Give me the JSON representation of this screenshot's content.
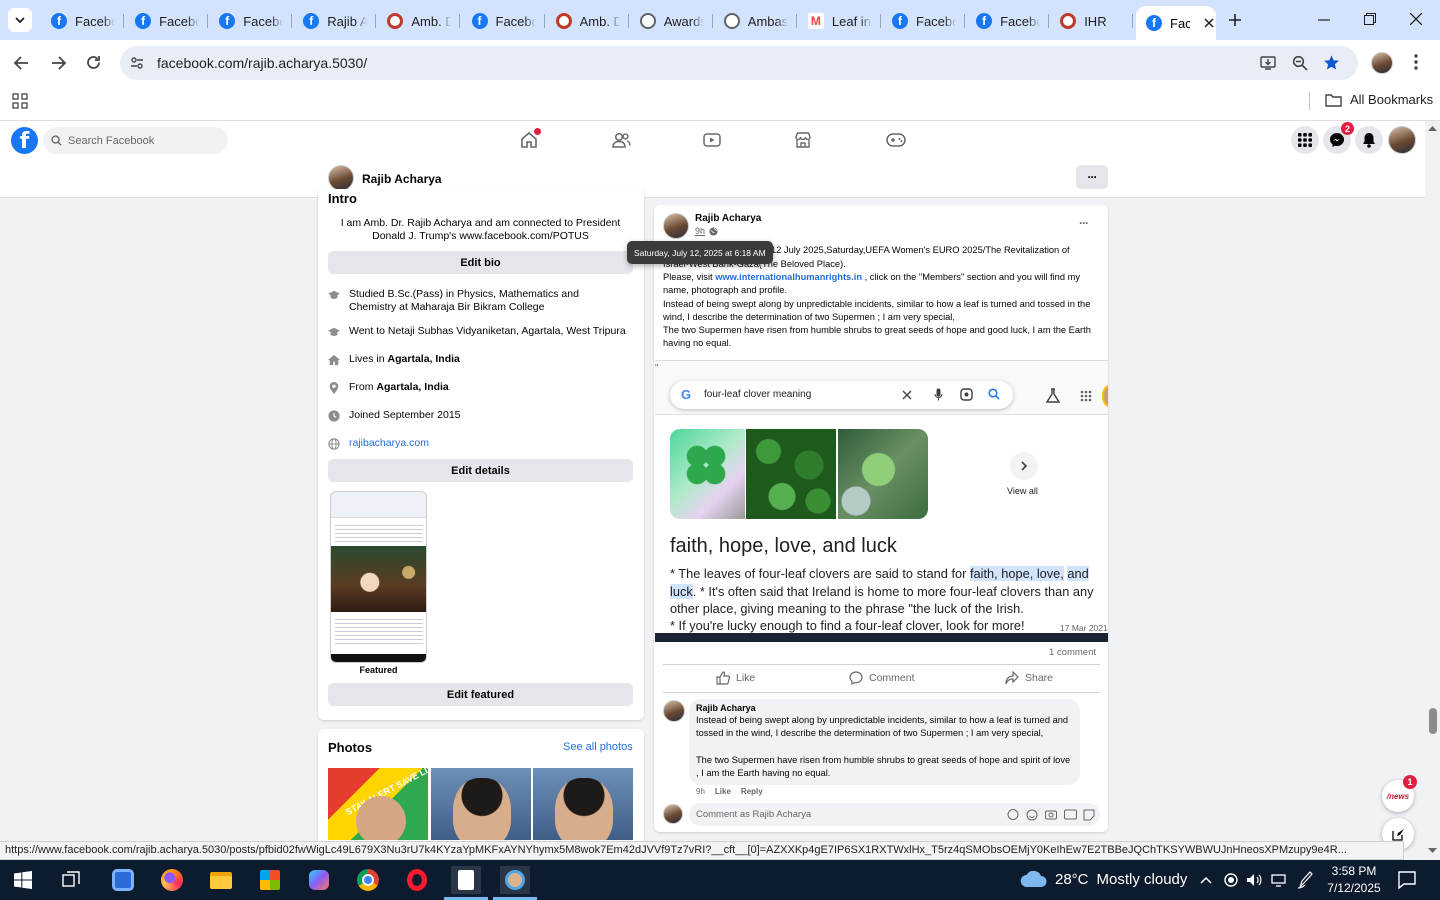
{
  "browser": {
    "tabs": [
      {
        "title": "Facebook",
        "icon": "facebook-icon"
      },
      {
        "title": "Facebook",
        "icon": "facebook-icon"
      },
      {
        "title": "Facebook",
        "icon": "facebook-icon"
      },
      {
        "title": "Rajib Acharya",
        "icon": "facebook-icon"
      },
      {
        "title": "Amb. Dr.",
        "icon": "ihr-icon"
      },
      {
        "title": "Facebook",
        "icon": "facebook-icon"
      },
      {
        "title": "Amb. Dr.",
        "icon": "ihr-icon"
      },
      {
        "title": "Awards",
        "icon": "globe-icon"
      },
      {
        "title": "Ambassador",
        "icon": "globe-icon"
      },
      {
        "title": "Leaf in",
        "icon": "gmail-icon"
      },
      {
        "title": "Facebook",
        "icon": "facebook-icon"
      },
      {
        "title": "Facebook",
        "icon": "facebook-icon"
      },
      {
        "title": "IHR",
        "icon": "ihr-icon"
      }
    ],
    "active_tab": "Facebook",
    "url": "facebook.com/rajib.acharya.5030/",
    "all_bookmarks": "All Bookmarks",
    "status_url": "https://www.facebook.com/rajib.acharya.5030/posts/pfbid02fwWigLc49L679X3Nu3rU7k4KYzaYpMKFxAYNYhymx5M8wok7Em42dJVVf9Tz7vRI?__cft__[0]=AZXXKp4gE7IP6SX1RXTWxlHx_T5rz4qSMObsOEMjY0KeIhEw7E2TBBeJQChTKSYWBWUJnHneosXPMzupy9e4R..."
  },
  "facebook": {
    "search_placeholder": "Search Facebook",
    "messenger_badge": "2",
    "profile_name": "Rajib Acharya",
    "more_label": "···",
    "intro": {
      "heading": "Intro",
      "bio": "I am Amb. Dr. Rajib Acharya and am connected to President Donald J. Trump's www.facebook.com/POTUS",
      "edit_bio": "Edit bio",
      "studied": "Studied B.Sc.(Pass) in Physics, Mathematics and Chemistry at Maharaja Bir Bikram College",
      "went_to": "Went to Netaji Subhas Vidyaniketan, Agartala, West Tripura",
      "lives_prefix": "Lives in ",
      "lives_place": "Agartala, India",
      "from_prefix": "From ",
      "from_place": "Agartala, India",
      "joined": "Joined September 2015",
      "website": "rajibacharya.com",
      "edit_details": "Edit details",
      "featured_label": "Featured",
      "edit_featured": "Edit featured"
    },
    "photos": {
      "heading": "Photos",
      "see_all": "See all photos",
      "sticker_text": "STAY ALERT SAVE LIVES"
    },
    "post": {
      "author": "Rajib Acharya",
      "time": "9h",
      "tooltip": "Saturday, July 12, 2025 at 6:18 AM",
      "line1": "12 July 2025,Saturday,UEFA Women's EURO 2025/The Revitalization of",
      "line2": "Israel-West Bank-Gaza(The Beloved Place).",
      "visit_prefix": "Please, visit ",
      "visit_link": "www.internationalhumanrights.in",
      "visit_suffix": " , click on the \"Members\" section and you will find my name, photograph and profile.",
      "para2": "Instead of being swept along by unpredictable incidents, similar to how a leaf is turned and tossed in the wind, I describe the determination of two Supermen ; I am very special,",
      "para3": "The two Supermen have risen from humble shrubs to great seeds of hope and good luck, I am the Earth having no equal.",
      "comments_count": "1 comment",
      "like": "Like",
      "comment": "Comment",
      "share": "Share"
    },
    "screenshot": {
      "search_query": "four-leaf clover meaning",
      "view_all": "View all",
      "heading": "faith, hope, love, and luck",
      "p1_prefix": "* The leaves of four-leaf clovers are said to stand for ",
      "p1_highlight1": "faith, hope, love,",
      "p1_highlight2": "and luck",
      "p1_rest": ". * It's often said that Ireland is home to more four-leaf clovers than any other place, giving meaning to the phrase \"the luck of the Irish.",
      "p2": "* If you're lucky enough to find a four-leaf clover, look for more!",
      "date": "17 Mar 2021"
    },
    "comment": {
      "author": "Rajib Acharya",
      "text1": "Instead of being swept along by unpredictable incidents, similar to how a leaf is turned and tossed in the wind, I describe the determination of two Supermen ; I am very special,",
      "text2": "The two Supermen have risen from humble shrubs to great seeds of hope and spirit of love , I am the Earth having no equal.",
      "time": "9h",
      "like": "Like",
      "reply": "Reply",
      "input_placeholder": "Comment as Rajib Acharya"
    },
    "chat_badge": "1"
  },
  "taskbar": {
    "weather_temp": "28°C",
    "weather_text": "Mostly cloudy",
    "time": "3:58 PM",
    "date": "7/12/2025"
  },
  "colors": {
    "facebook_blue": "#1877f2",
    "tabstrip": "#d3e3fd",
    "taskbar": "#0d1b2e",
    "badge_red": "#e41e3f"
  }
}
